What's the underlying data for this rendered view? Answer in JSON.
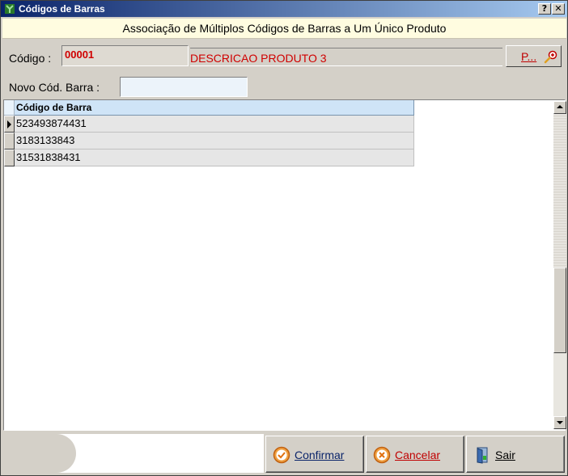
{
  "window": {
    "title": "Códigos de Barras",
    "help_glyph": "?",
    "close_glyph": "✕"
  },
  "header": {
    "banner": "Associação de Múltiplos Códigos de Barras a Um Único Produto"
  },
  "product": {
    "codigo_label": "Código :",
    "codigo_value": "00001",
    "descricao": "DESCRICAO PRODUTO 3",
    "search_button_label": "P..."
  },
  "novo": {
    "label": "Novo Cód. Barra  :",
    "value": ""
  },
  "grid": {
    "column_header": "Código de Barra",
    "rows": [
      "523493874431",
      "3183133843",
      "31531838431"
    ]
  },
  "actions": {
    "confirmar": "Confirmar",
    "cancelar": "Cancelar",
    "sair": "Sair"
  },
  "colors": {
    "accent_red": "#d00000",
    "title_bar": "#0a246a",
    "banner_bg": "#fffce0"
  }
}
